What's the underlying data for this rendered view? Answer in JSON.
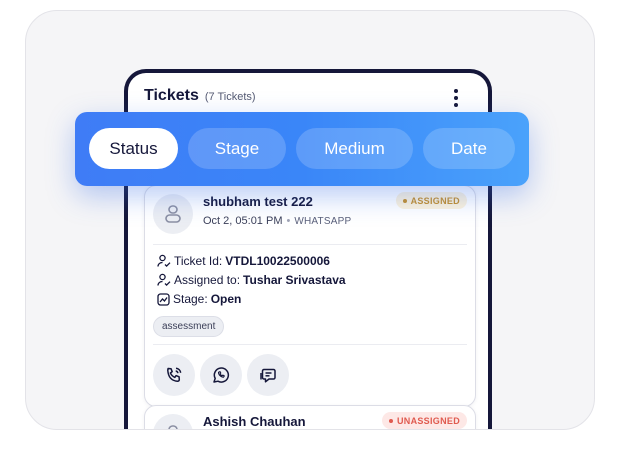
{
  "header": {
    "title": "Tickets",
    "count": "(7 Tickets)"
  },
  "filters": [
    {
      "label": "Status",
      "active": true
    },
    {
      "label": "Stage",
      "active": false
    },
    {
      "label": "Medium",
      "active": false
    },
    {
      "label": "Date",
      "active": false
    }
  ],
  "tickets": [
    {
      "name": "shubham test 222",
      "datetime": "Oct 2, 05:01 PM",
      "separator": "•",
      "medium": "WHATSAPP",
      "status": "ASSIGNED",
      "ticket_id_label": "Ticket Id:",
      "ticket_id": "VTDL10022500006",
      "assigned_label": "Assigned to:",
      "assigned_to": "Tushar Srivastava",
      "stage_label": "Stage:",
      "stage": "Open",
      "tag": "assessment",
      "actions": [
        "call-icon",
        "whatsapp-icon",
        "chat-icon"
      ]
    },
    {
      "name": "Ashish Chauhan",
      "status": "UNASSIGNED"
    }
  ],
  "colors": {
    "filter_gradient_start": "#3f7cf6",
    "filter_gradient_end": "#4aa2fb",
    "text_dark": "#15173a",
    "assigned": "#c7902a",
    "unassigned": "#e05a4f"
  }
}
